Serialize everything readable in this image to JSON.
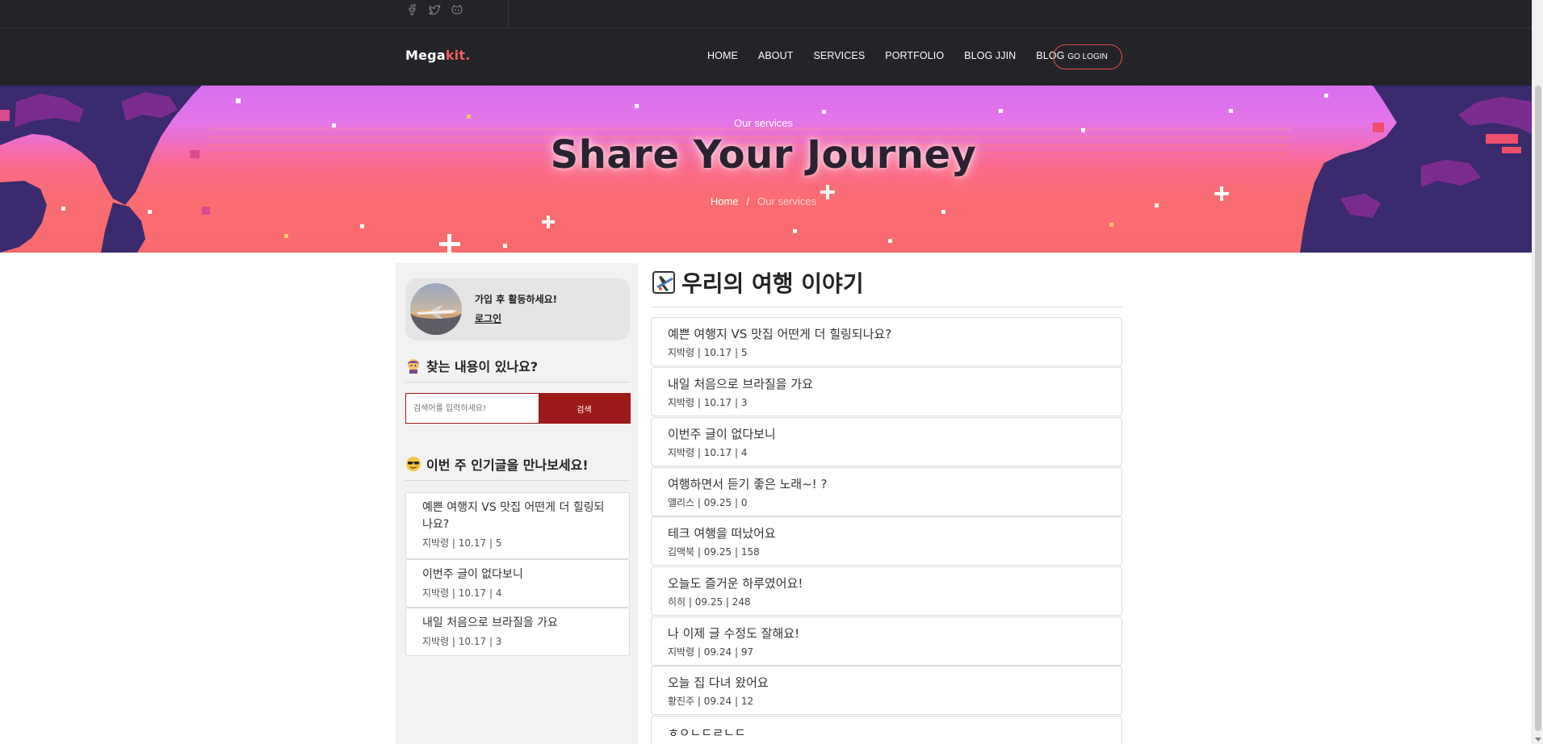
{
  "topbar": {
    "social": [
      "facebook-icon",
      "twitter-icon",
      "github-icon"
    ]
  },
  "navbar": {
    "logo_main": "Mega",
    "logo_accent": "kit.",
    "links": [
      "HOME",
      "ABOUT",
      "SERVICES",
      "PORTFOLIO",
      "BLOG JJIN",
      "BLOG"
    ],
    "login_label": "GO LOGIN"
  },
  "hero": {
    "eyebrow": "Our services",
    "title": "Share Your Journey",
    "crumb_home": "Home",
    "crumb_sep": "/",
    "crumb_current": "Our services"
  },
  "sidebar": {
    "profile_message": "가입 후 활동하세요!",
    "profile_login": "로그인",
    "search_heading": "찾는 내용이 있나요?",
    "search_placeholder": "검색어를 입력하세요!",
    "search_button": "검색",
    "popular_heading": "이번 주 인기글을 만나보세요!",
    "popular": [
      {
        "title": "예쁜 여행지 VS 맛집 어떤게 더 힐링되나요?",
        "meta": "지박령 | 10.17 | 5"
      },
      {
        "title": "이번주 글이 없다보니",
        "meta": "지박령 | 10.17 | 4"
      },
      {
        "title": "내일 처음으로 브라질을 가요",
        "meta": "지박령 | 10.17 | 3"
      }
    ]
  },
  "main": {
    "title": "우리의 여행 이야기",
    "posts": [
      {
        "title": "예쁜 여행지 VS 맛집 어떤게 더 힐링되나요?",
        "meta": "지박령 | 10.17 | 5"
      },
      {
        "title": "내일 처음으로 브라질을 가요",
        "meta": "지박령 | 10.17 | 3"
      },
      {
        "title": "이번주 글이 없다보니",
        "meta": "지박령 | 10.17 | 4"
      },
      {
        "title": "여행하면서 듣기 좋은 노래~! ?",
        "meta": "앨리스 | 09.25 | 0"
      },
      {
        "title": "테크 여행을 떠났어요",
        "meta": "김맥북 | 09.25 | 158"
      },
      {
        "title": "오늘도 즐거운 하루였어요!",
        "meta": "히히 | 09.25 | 248"
      },
      {
        "title": "나 이제 글 수정도 잘해요!",
        "meta": "지박령 | 09.24 | 97"
      },
      {
        "title": "오늘 집 다녀 왔어요",
        "meta": "황진주 | 09.24 | 12"
      },
      {
        "title": "ㅎㅇㄴㄷㄹㄴㄷ",
        "meta": ""
      }
    ]
  },
  "colors": {
    "nav_bg": "#232328",
    "accent": "#f25e5e",
    "search_red": "#9d1a1a",
    "hero_top": "#d86fef",
    "hero_bottom": "#fb6d70",
    "pixel_dark": "#3a2a6e"
  }
}
